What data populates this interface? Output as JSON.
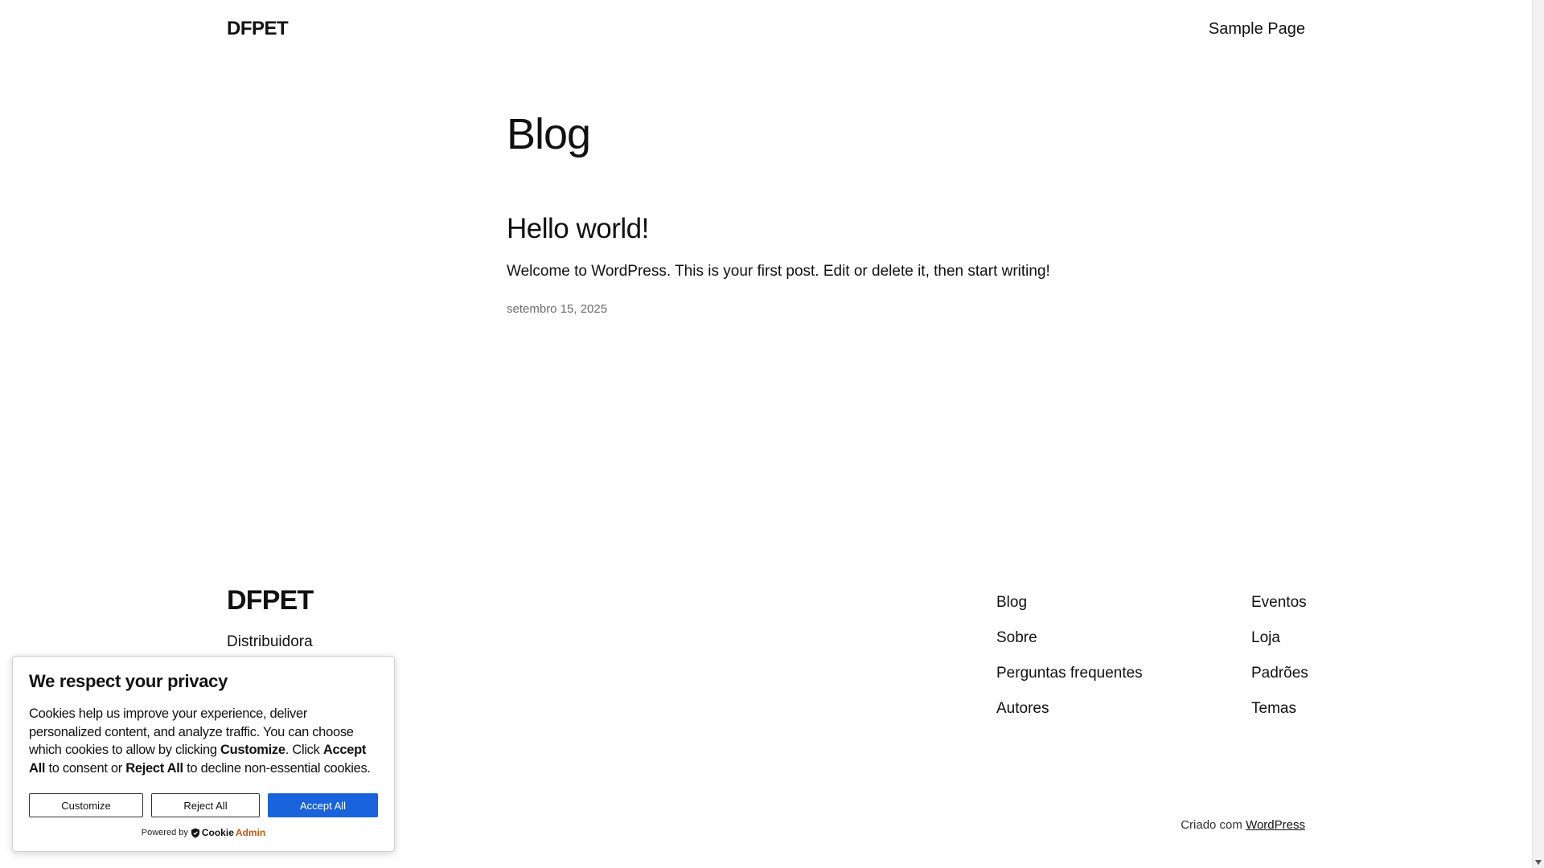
{
  "header": {
    "site_title": "DFPET",
    "nav": [
      "Sample Page"
    ]
  },
  "main": {
    "heading": "Blog",
    "posts": [
      {
        "title": "Hello world!",
        "excerpt": "Welcome to WordPress. This is your first post. Edit or delete it, then start writing!",
        "date": "setembro 15, 2025"
      }
    ]
  },
  "footer": {
    "title": "DFPET",
    "tagline": "Distribuidora",
    "col1": [
      "Blog",
      "Sobre",
      "Perguntas frequentes",
      "Autores"
    ],
    "col2": [
      "Eventos",
      "Loja",
      "Padrões",
      "Temas"
    ],
    "credit_prefix": "Criado com",
    "credit_link": "WordPress"
  },
  "cookie": {
    "title": "We respect your privacy",
    "text_1": "Cookies help us improve your experience, deliver personalized content, and analyze traffic. You can choose which cookies to allow by clicking ",
    "bold_customize": "Customize",
    "text_2": ". Click ",
    "bold_accept": "Accept All",
    "text_3": " to consent or ",
    "bold_reject": "Reject All",
    "text_4": " to decline non-essential cookies.",
    "btn_customize": "Customize",
    "btn_reject": "Reject All",
    "btn_accept": "Accept All",
    "powered_by": "Powered by",
    "brand_cookie": "Cookie",
    "brand_admin": "Admin",
    "accent_color": "#1863dc"
  }
}
